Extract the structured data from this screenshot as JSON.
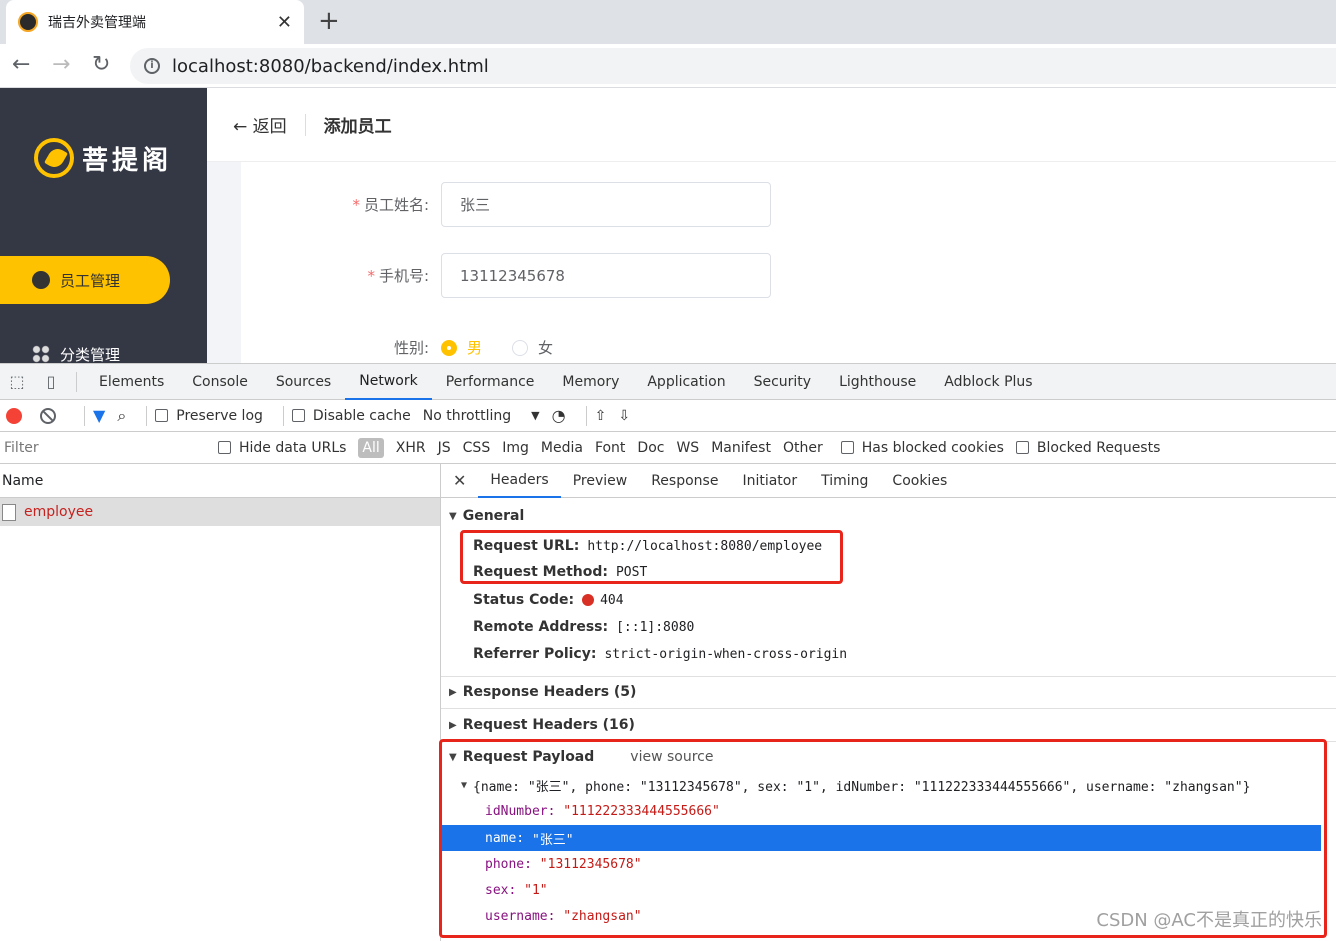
{
  "browser": {
    "tab_title": "瑞吉外卖管理端",
    "url": "localhost:8080/backend/index.html"
  },
  "app": {
    "logo_text": "菩提阁",
    "menu": [
      {
        "label": "员工管理",
        "active": true
      },
      {
        "label": "分类管理",
        "active": false
      }
    ],
    "back_label": "返回",
    "page_title": "添加员工",
    "form": {
      "name_label": "员工姓名:",
      "name_value": "张三",
      "phone_label": "手机号:",
      "phone_value": "13112345678",
      "sex_label": "性别:",
      "sex_male": "男",
      "sex_female": "女"
    }
  },
  "devtools": {
    "tabs": [
      "Elements",
      "Console",
      "Sources",
      "Network",
      "Performance",
      "Memory",
      "Application",
      "Security",
      "Lighthouse",
      "Adblock Plus"
    ],
    "active_tab": "Network",
    "toolbar": {
      "preserve_log": "Preserve log",
      "disable_cache": "Disable cache",
      "throttling": "No throttling"
    },
    "filter": {
      "placeholder": "Filter",
      "hide_data_urls": "Hide data URLs",
      "types": [
        "All",
        "XHR",
        "JS",
        "CSS",
        "Img",
        "Media",
        "Font",
        "Doc",
        "WS",
        "Manifest",
        "Other"
      ],
      "has_blocked_cookies": "Has blocked cookies",
      "blocked_requests": "Blocked Requests"
    },
    "requests": {
      "column_name": "Name",
      "items": [
        "employee"
      ]
    },
    "detail_tabs": [
      "Headers",
      "Preview",
      "Response",
      "Initiator",
      "Timing",
      "Cookies"
    ],
    "general": {
      "title": "General",
      "request_url_label": "Request URL:",
      "request_url": "http://localhost:8080/employee",
      "request_method_label": "Request Method:",
      "request_method": "POST",
      "status_code_label": "Status Code:",
      "status_code": "404",
      "remote_address_label": "Remote Address:",
      "remote_address": "[::1]:8080",
      "referrer_policy_label": "Referrer Policy:",
      "referrer_policy": "strict-origin-when-cross-origin"
    },
    "response_headers": "Response Headers (5)",
    "request_headers": "Request Headers (16)",
    "payload": {
      "title": "Request Payload",
      "view_source": "view source",
      "summary": "{name: \"张三\", phone: \"13112345678\", sex: \"1\", idNumber: \"111222333444555666\", username: \"zhangsan\"}",
      "fields": [
        {
          "key": "idNumber:",
          "value": "\"111222333444555666\""
        },
        {
          "key": "name:",
          "value": "\"张三\""
        },
        {
          "key": "phone:",
          "value": "\"13112345678\""
        },
        {
          "key": "sex:",
          "value": "\"1\""
        },
        {
          "key": "username:",
          "value": "\"zhangsan\""
        }
      ]
    }
  },
  "watermark": "CSDN @AC不是真正的快乐"
}
